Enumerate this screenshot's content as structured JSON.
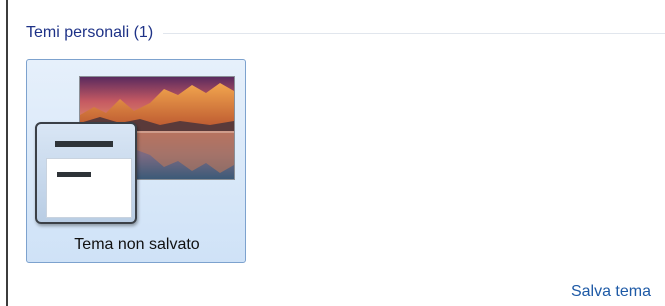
{
  "personal_themes": {
    "group_title": "Temi personali (1)",
    "themes": [
      {
        "label": "Tema non salvato",
        "selected": true
      }
    ]
  },
  "actions": {
    "save_theme_link": "Salva tema"
  },
  "colors": {
    "group_title": "#1e3287",
    "link": "#1e5aa6",
    "tile_selected_bg": "#cfe2f7",
    "tile_selected_border": "#7da2ce"
  }
}
